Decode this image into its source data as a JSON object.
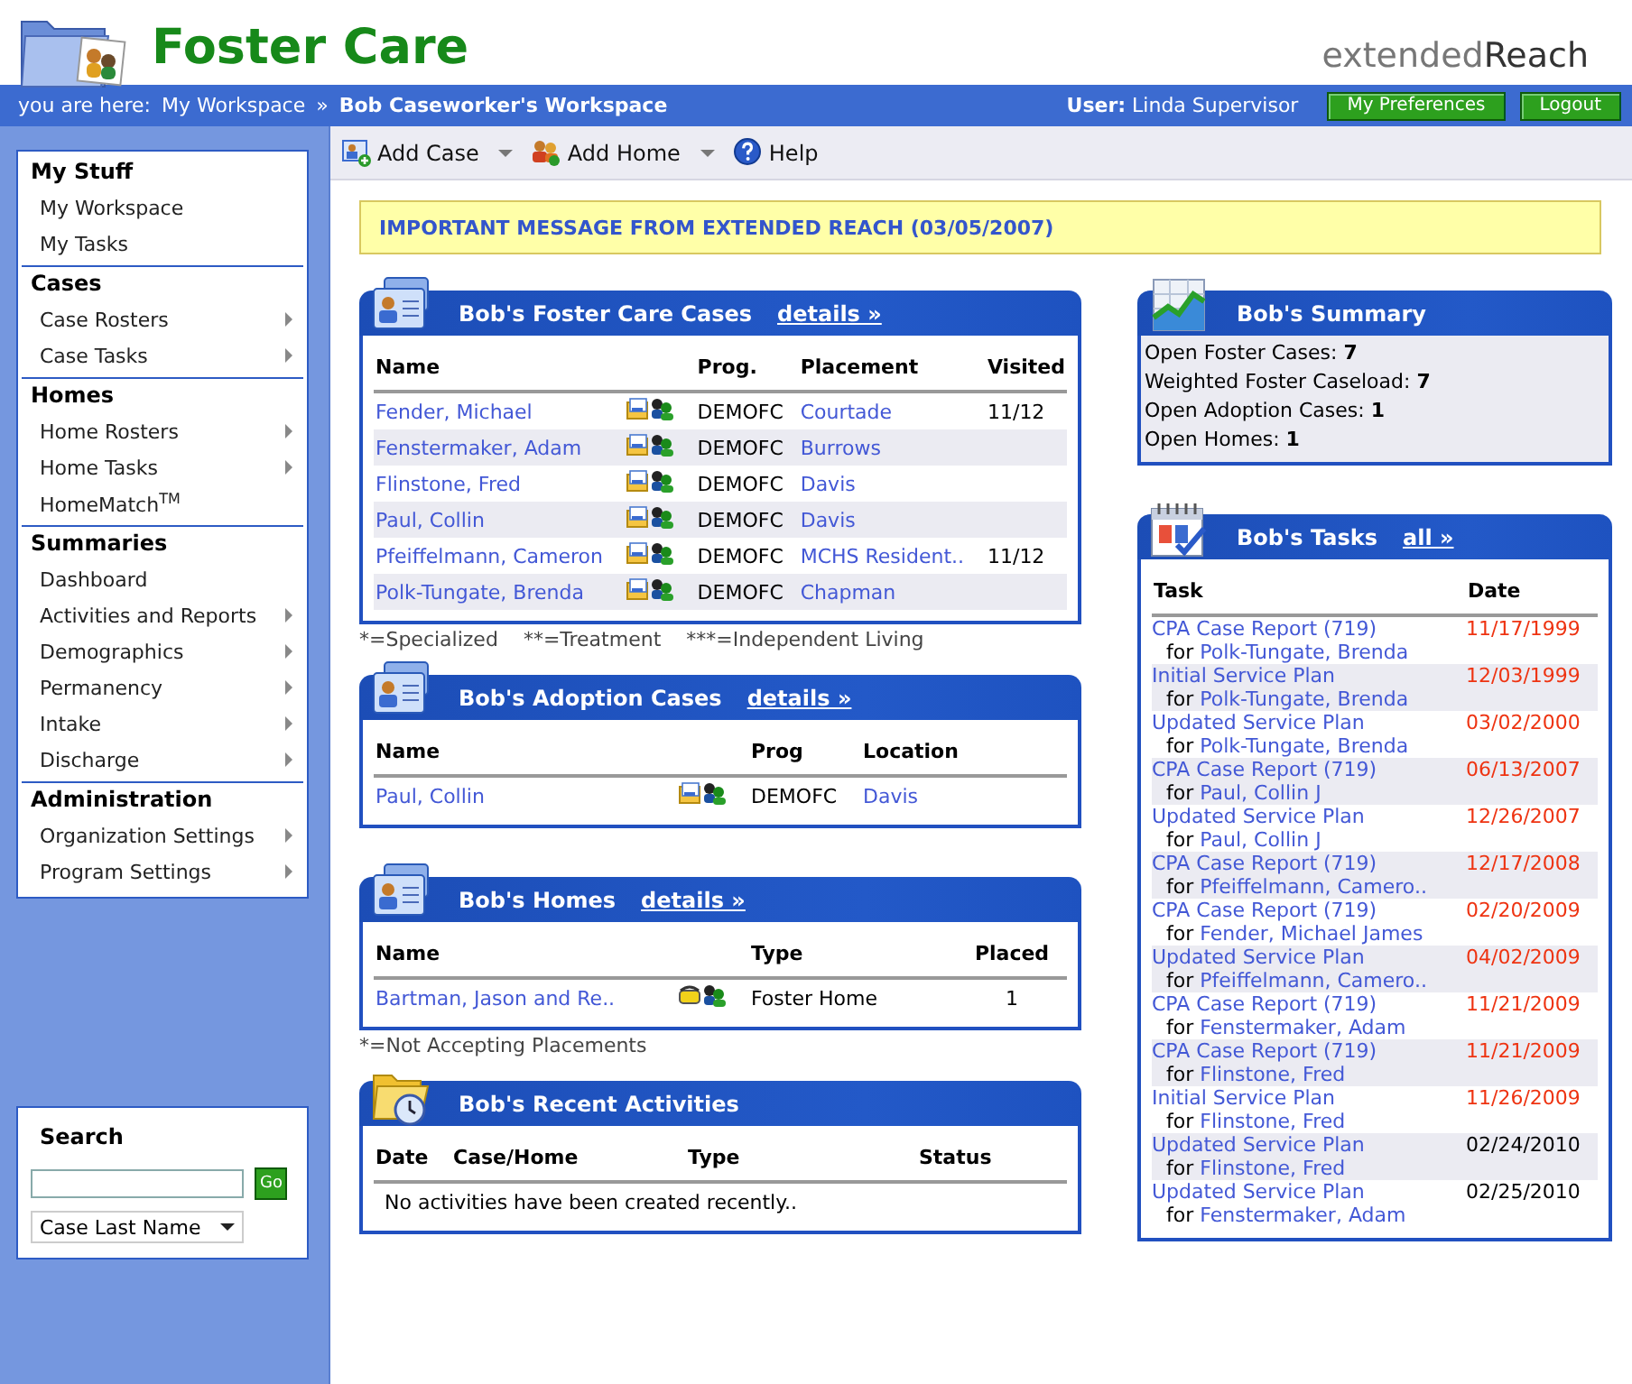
{
  "header": {
    "title": "Foster Care",
    "brand_parts": [
      "extended",
      "Reach"
    ]
  },
  "breadcrumb": {
    "label": "you are here:",
    "separator": "»",
    "items": [
      {
        "text": "My Workspace",
        "current": false
      },
      {
        "text": "Bob Caseworker's Workspace",
        "current": true
      }
    ]
  },
  "user": {
    "label": "User:",
    "name": "Linda Supervisor"
  },
  "header_buttons": [
    "My Preferences",
    "Logout"
  ],
  "toolbar": [
    {
      "kind": "case",
      "label": "Add Case",
      "dropdown": true
    },
    {
      "kind": "home",
      "label": "Add Home",
      "dropdown": true
    },
    {
      "kind": "help",
      "label": "Help",
      "dropdown": false
    }
  ],
  "message": "IMPORTANT MESSAGE FROM EXTENDED REACH (03/05/2007)",
  "sidebar": {
    "sections": [
      {
        "title": "My Stuff",
        "items": [
          {
            "label": "My Workspace",
            "submenu": false
          },
          {
            "label": "My Tasks",
            "submenu": false
          }
        ]
      },
      {
        "title": "Cases",
        "items": [
          {
            "label": "Case Rosters",
            "submenu": true
          },
          {
            "label": "Case Tasks",
            "submenu": true
          }
        ]
      },
      {
        "title": "Homes",
        "items": [
          {
            "label": "Home Rosters",
            "submenu": true
          },
          {
            "label": "Home Tasks",
            "submenu": true
          },
          {
            "label": "HomeMatch$^{TM}$",
            "submenu": false
          }
        ]
      },
      {
        "title": "Summaries",
        "items": [
          {
            "label": "Dashboard",
            "submenu": false
          },
          {
            "label": "Activities and Reports",
            "submenu": true
          },
          {
            "label": "Demographics",
            "submenu": true
          },
          {
            "label": "Permanency",
            "submenu": true
          },
          {
            "label": "Intake",
            "submenu": true
          },
          {
            "label": "Discharge",
            "submenu": true
          }
        ]
      },
      {
        "title": "Administration",
        "items": [
          {
            "label": "Organization Settings",
            "submenu": true
          },
          {
            "label": "Program Settings",
            "submenu": true
          }
        ]
      }
    ]
  },
  "search": {
    "title": "Search",
    "button": "Go",
    "field_option": "Case Last Name"
  },
  "foster_cases": {
    "title": "Bob's Foster Care Cases",
    "link": "details »",
    "columns": [
      "Name",
      "Prog.",
      "Placement",
      "Visited"
    ],
    "rows": [
      {
        "name": "Fender, Michael",
        "prog": "DEMOFC",
        "placement": "Courtade",
        "visited": "11/12"
      },
      {
        "name": "Fenstermaker, Adam",
        "prog": "DEMOFC",
        "placement": "Burrows"
      },
      {
        "name": "Flinstone, Fred",
        "prog": "DEMOFC",
        "placement": "Davis"
      },
      {
        "name": "Paul, Collin",
        "prog": "DEMOFC",
        "placement": "Davis"
      },
      {
        "name": "Pfeiffelmann, Cameron",
        "prog": "DEMOFC",
        "placement": "MCHS Resident..",
        "visited": "11/12"
      },
      {
        "name": "Polk-Tungate, Brenda",
        "prog": "DEMOFC",
        "placement": "Chapman"
      }
    ],
    "footnotes": [
      "*=Specialized",
      "**=Treatment",
      "***=Independent Living"
    ]
  },
  "adoption_cases": {
    "title": "Bob's Adoption Cases",
    "link": "details »",
    "columns": [
      "Name",
      "Prog",
      "Location"
    ],
    "rows": [
      {
        "name": "Paul, Collin",
        "prog": "DEMOFC",
        "location": "Davis"
      }
    ]
  },
  "homes": {
    "title": "Bob's Homes",
    "link": "details »",
    "columns": [
      "Name",
      "Type",
      "Placed"
    ],
    "rows": [
      {
        "name": "Bartman, Jason and Re..",
        "type": "Foster Home",
        "placed": "1"
      }
    ],
    "footnotes": [
      "*=Not Accepting Placements"
    ]
  },
  "activities": {
    "title": "Bob's Recent Activities",
    "columns": [
      "Date",
      "Case/Home",
      "Type",
      "Status"
    ],
    "empty": "No activities have been created recently.."
  },
  "summary": {
    "title": "Bob's Summary",
    "lines": [
      "Open Foster Cases: **7**",
      "Weighted Foster Caseload: **7**",
      "Open Adoption Cases: **1**",
      "Open Homes: **1**"
    ]
  },
  "tasks": {
    "title": "Bob's Tasks",
    "link": "all »",
    "columns": [
      "Task",
      "Date"
    ],
    "rows": [
      {
        "task": "CPA Case Report (719)",
        "for_label": "for",
        "for": "Polk-Tungate, Brenda",
        "date": "11/17/1999",
        "overdue": true
      },
      {
        "task": "Initial Service Plan",
        "for_label": "for",
        "for": "Polk-Tungate, Brenda",
        "date": "12/03/1999",
        "overdue": true
      },
      {
        "task": "Updated Service Plan",
        "for_label": "for",
        "for": "Polk-Tungate, Brenda",
        "date": "03/02/2000",
        "overdue": true
      },
      {
        "task": "CPA Case Report (719)",
        "for_label": "for",
        "for": "Paul, Collin J",
        "date": "06/13/2007",
        "overdue": true
      },
      {
        "task": "Updated Service Plan",
        "for_label": "for",
        "for": "Paul, Collin J",
        "date": "12/26/2007",
        "overdue": true
      },
      {
        "task": "CPA Case Report (719)",
        "for_label": "for",
        "for": "Pfeiffelmann, Camero..",
        "date": "12/17/2008",
        "overdue": true
      },
      {
        "task": "CPA Case Report (719)",
        "for_label": "for",
        "for": "Fender, Michael James",
        "date": "02/20/2009",
        "overdue": true
      },
      {
        "task": "Updated Service Plan",
        "for_label": "for",
        "for": "Pfeiffelmann, Camero..",
        "date": "04/02/2009",
        "overdue": true
      },
      {
        "task": "CPA Case Report (719)",
        "for_label": "for",
        "for": "Fenstermaker, Adam",
        "date": "11/21/2009",
        "overdue": true
      },
      {
        "task": "CPA Case Report (719)",
        "for_label": "for",
        "for": "Flinstone, Fred",
        "date": "11/21/2009",
        "overdue": true
      },
      {
        "task": "Initial Service Plan",
        "for_label": "for",
        "for": "Flinstone, Fred",
        "date": "11/26/2009",
        "overdue": true
      },
      {
        "task": "Updated Service Plan",
        "for_label": "for",
        "for": "Flinstone, Fred",
        "date": "02/24/2010",
        "overdue": false
      },
      {
        "task": "Updated Service Plan",
        "for_label": "for",
        "for": "Fenstermaker, Adam",
        "date": "02/25/2010",
        "overdue": false
      }
    ]
  }
}
